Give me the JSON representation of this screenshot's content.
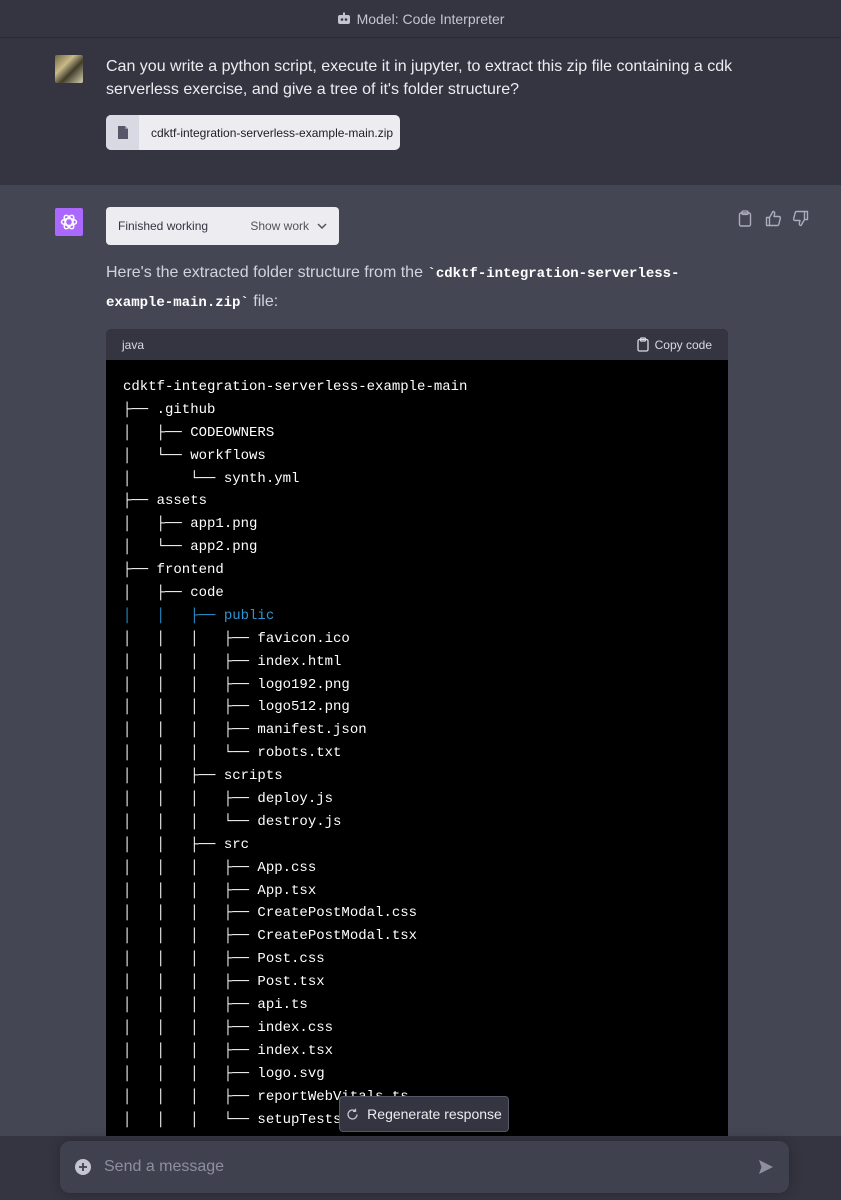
{
  "topbar": {
    "model_label": "Model: Code Interpreter"
  },
  "user_message": {
    "text": "Can you write a python script, execute it in jupyter, to extract this zip file containing a cdk serverless exercise, and give a tree of it's folder structure?",
    "attachment": "cdktf-integration-serverless-example-main.zip"
  },
  "assistant": {
    "work_status": "Finished working",
    "show_work_label": "Show work",
    "reply_prefix": "Here's the extracted folder structure from the ",
    "reply_code": "`cdktf-integration-serverless-example-main.zip`",
    "reply_suffix": " file:",
    "codeblock": {
      "language": "java",
      "copy_label": "Copy code",
      "lines": [
        "cdktf-integration-serverless-example-main",
        "├── .github",
        "│   ├── CODEOWNERS",
        "│   └── workflows",
        "│       └── synth.yml",
        "├── assets",
        "│   ├── app1.png",
        "│   └── app2.png",
        "├── frontend",
        "│   ├── code",
        "│   │   ├── public",
        "│   │   │   ├── favicon.ico",
        "│   │   │   ├── index.html",
        "│   │   │   ├── logo192.png",
        "│   │   │   ├── logo512.png",
        "│   │   │   ├── manifest.json",
        "│   │   │   └── robots.txt",
        "│   │   ├── scripts",
        "│   │   │   ├── deploy.js",
        "│   │   │   └── destroy.js",
        "│   │   ├── src",
        "│   │   │   ├── App.css",
        "│   │   │   ├── App.tsx",
        "│   │   │   ├── CreatePostModal.css",
        "│   │   │   ├── CreatePostModal.tsx",
        "│   │   │   ├── Post.css",
        "│   │   │   ├── Post.tsx",
        "│   │   │   ├── api.ts",
        "│   │   │   ├── index.css",
        "│   │   │   ├── index.tsx",
        "│   │   │   ├── logo.svg",
        "│   │   │   ├── reportWebVitals.ts",
        "│   │   │   └── setupTests.ts"
      ]
    }
  },
  "regenerate_label": "Regenerate response",
  "composer": {
    "placeholder": "Send a message"
  }
}
